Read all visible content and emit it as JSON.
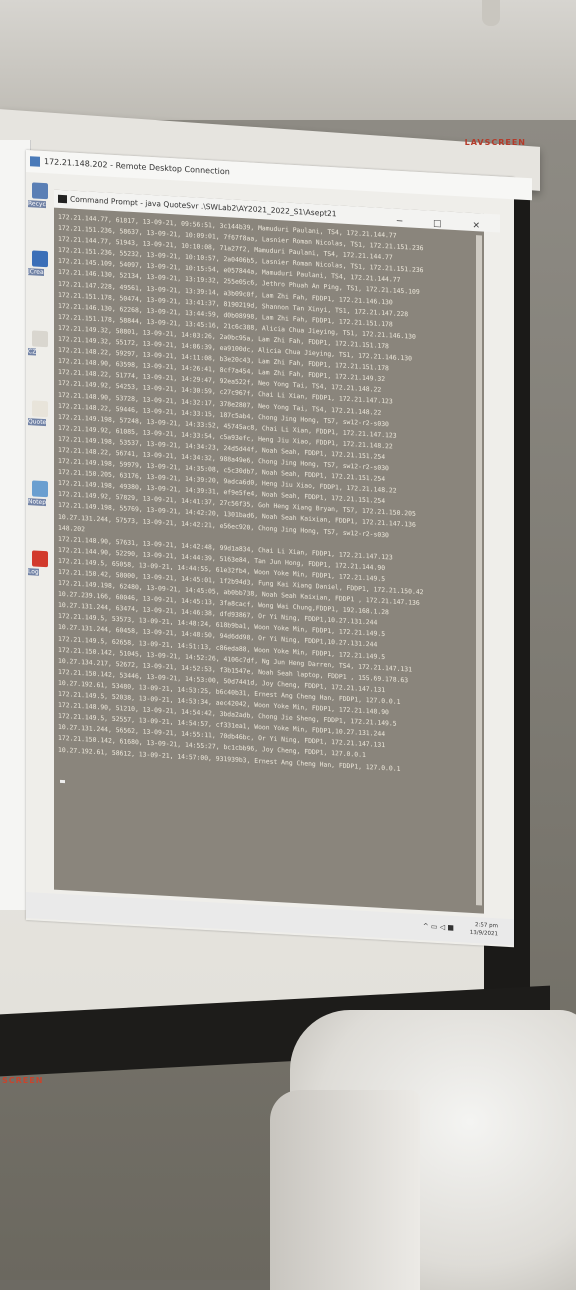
{
  "screen": {
    "brand_top": "LAVSCREEN",
    "brand_bottom": "SCREEN"
  },
  "rdp_window": {
    "title": "172.21.148.202 - Remote Desktop Connection"
  },
  "cmd_window": {
    "title": "Command Prompt - java QuoteSvr .\\SWLab2\\AY2021_2022_S1\\Asept21",
    "controls": "─ □ ✕",
    "log_lines": [
      "172.21.144.77, 61817, 13-09-21, 09:56:51, 3c144b39, Mamuduri Paulani, TS4, 172.21.144.77",
      "172.21.151.236, 58637, 13-09-21, 10:09:01, 7f67f8aa, Lasnier Roman Nicolas, TS1, 172.21.151.236",
      "172.21.144.77, 51943, 13-09-21, 10:10:08, 71a27f2, Mamuduri Paulani, TS4, 172.21.144.77",
      "172.21.151.236, 55232, 13-09-21, 10:10:57, 2a0406b5, Lasnier Roman Nicolas, TS1, 172.21.151.236",
      "172.21.145.109, 54097, 13-09-21, 10:15:54, e057844a, Mamuduri Paulani, TS4, 172.21.144.77",
      "172.21.146.130, 52134, 13-09-21, 13:19:32, 255e05c6, Jethro Phuah An Ping, TS1, 172.21.145.109",
      "172.21.147.228, 49561, 13-09-21, 13:39:14, a3b09c0f, Lam Zhi Fah, FDDP1, 172.21.146.130",
      "172.21.151.178, 50474, 13-09-21, 13:41:37, 8190219d, Shannon Tan Xinyi, TS1, 172.21.147.228",
      "172.21.146.130, 62268, 13-09-21, 13:44:59, d0b08998, Lam Zhi Fah, FDDP1, 172.21.151.178",
      "172.21.151.178, 58844, 13-09-21, 13:45:16, 21c6c388, Alicia Chua Jieying, TS1, 172.21.146.130",
      "172.21.149.32, 58801, 13-09-21, 14:03:26, 2a0bc95a, Lam Zhi Fah, FDDP1, 172.21.151.178",
      "172.21.149.32, 55172, 13-09-21, 14:06:39, ea9100dc, Alicia Chua Jieying, TS1, 172.21.146.130",
      "172.21.148.22, 59297, 13-09-21, 14:11:08, b3e20c43, Lam Zhi Fah, FDDP1, 172.21.151.178",
      "172.21.148.90, 63598, 13-09-21, 14:26:41, 8cf7a454, Lam Zhi Fah, FDDP1, 172.21.149.32",
      "172.21.148.22, 51774, 13-09-21, 14:29:47, 92ea522f, Neo Yong Tai, TS4, 172.21.148.22",
      "172.21.149.92, 54253, 13-09-21, 14:30:59, c27c967f, Chai Li Xian, FDDP1, 172.21.147.123",
      "172.21.148.90, 53728, 13-09-21, 14:32:17, 378e2807, Neo Yong Tai, TS4, 172.21.148.22",
      "172.21.148.22, 59446, 13-09-21, 14:33:15, 187c5ab4, Chong Jing Hong, TS7, sw12-r2-s030",
      "172.21.149.198, 57248, 13-09-21, 14:33:52, 45745ac8, Chai Li Xian, FDDP1, 172.21.147.123",
      "172.21.149.92, 61085, 13-09-21, 14:33:54, c5a93efc, Heng Jiu Xiao, FDDP1, 172.21.148.22",
      "172.21.149.198, 53537, 13-09-21, 14:34:23, 24d5d44f, Noah Seah, FDDP1, 172.21.151.254",
      "172.21.148.22, 56741, 13-09-21, 14:34:32, 988a49e6, Chong Jing Hong, TS7, sw12-r2-s030",
      "172.21.149.198, 59979, 13-09-21, 14:35:08, c5c30db7, Noah Seah, FDDP1, 172.21.151.254",
      "172.21.150.205, 63176, 13-09-21, 14:39:20, 9adca6d0, Heng Jiu Xiao, FDDP1, 172.21.148.22",
      "172.21.149.198, 49380, 13-09-21, 14:39:31, ef9e5fe4, Noah Seah, FDDP1, 172.21.151.254",
      "172.21.149.92, 57829, 13-09-21, 14:41:37, 27c56f35, Goh Heng Xiang Bryan, TS7, 172.21.150.205",
      "172.21.149.198, 55769, 13-09-21, 14:42:20, 1301bad6, Noah Seah Kaixian, FDDP1, 172.21.147.136",
      "10.27.131.244, 57573, 13-09-21, 14:42:21, e56ec920, Chong Jing Hong, TS7, sw12-r2-s030",
      "148.202",
      "172.21.148.90, 57631, 13-09-21, 14:42:48, 99d1a834, Chai Li Xian, FDDP1, 172.21.147.123",
      "172.21.144.90, 52290, 13-09-21, 14:44:39, 5163e84, Tan Jun Hong, FDDP1, 172.21.144.90",
      "172.21.149.5, 65058, 13-09-21, 14:44:55, 61e32fb4, Woon Yoke Min, FDDP1, 172.21.149.5",
      "172.21.150.42, 58000, 13-09-21, 14:45:01, 1f2b94d3, Fung Kai Xiang Daniel, FDDP1, 172.21.150.42",
      "172.21.149.198, 62480, 13-09-21, 14:45:05, ab0bb738, Noah Seah Kaixian, FDDP1 , 172.21.147.136",
      "10.27.239.166, 60046, 13-09-21, 14:45:13, 3fa8cacf, Wong Wai Chung,FDDP1, 192.168.1.28",
      "10.27.131.244, 63474, 13-09-21, 14:46:38, dfd93867, Or Yi Ning, FDDP1,10.27.131.244",
      "172.21.149.5, 53573, 13-09-21, 14:48:24, 618b9ba1, Woon Yoke Min, FDDP1, 172.21.149.5",
      "10.27.131.244, 60458, 13-09-21, 14:48:50, 94d6dd98, Or Yi Ning, FDDP1,10.27.131.244",
      "172.21.149.5, 62658, 13-09-21, 14:51:13, c86eda88, Woon Yoke Min, FDDP1, 172.21.149.5",
      "172.21.150.142, 51045, 13-09-21, 14:52:26, 4106c7df, Ng Jun Heng Darren, TS4, 172.21.147.131",
      "10.27.134.217, 52672, 13-09-21, 14:52:53, f3b1547e, Noah Seah laptop, FDDP1 , 155.69.178.63",
      "172.21.150.142, 53446, 13-09-21, 14:53:00, 50d7441d, Joy Cheng, FDDP1, 172.21.147.131",
      "10.27.192.61, 53480, 13-09-21, 14:53:25, b6c40b31, Ernest Ang Cheng Han, FDDP1, 127.0.0.1",
      "172.21.149.5, 52038, 13-09-21, 14:53:34, aec42042, Woon Yoke Min, FDDP1, 172.21.148.90",
      "172.21.148.90, 51210, 13-09-21, 14:54:42, 3bda2adb, Chong Jie Sheng, FDDP1, 172.21.149.5",
      "172.21.149.5, 52557, 13-09-21, 14:54:57, cf331ea1, Woon Yoke Min, FDDP1,10.27.131.244",
      "10.27.131.244, 56562, 13-09-21, 14:55:11, 70db46bc, Or Yi Ning, FDDP1, 172.21.147.131",
      "172.21.150.142, 61680, 13-09-21, 14:55:27, bc1cbb96, Joy Cheng, FDDP1, 127.0.0.1",
      "10.27.192.61, 58612, 13-09-21, 14:57:00, 931939b3, Ernest Ang Cheng Han, FDDP1, 127.0.0.1"
    ]
  },
  "desktop_icons": [
    {
      "label": "Recyc",
      "color": "#5a7fb5"
    },
    {
      "label": "JCrea",
      "color": "#3b6fb8"
    },
    {
      "label": "CZ",
      "color": "#d9d6cf"
    },
    {
      "label": "Quote",
      "color": "#e8e4da"
    },
    {
      "label": "Notep",
      "color": "#6a9fd0"
    },
    {
      "label": "Log",
      "color": "#d23a2c"
    }
  ],
  "taskbar": {
    "time": "2:57 pm",
    "date": "13/9/2021",
    "tray_icons": "^ ▭ ◁ ■"
  }
}
